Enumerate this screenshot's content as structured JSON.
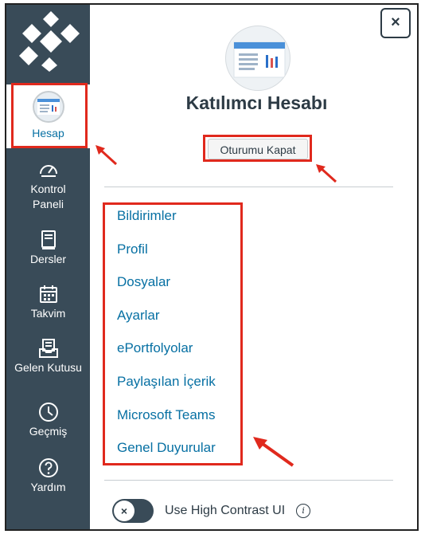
{
  "sidebar": {
    "items": [
      {
        "label": "Hesap",
        "icon": "avatar-icon",
        "active": true
      },
      {
        "label": "Kontrol\nPaneli",
        "icon": "dashboard-icon"
      },
      {
        "label": "Dersler",
        "icon": "courses-icon"
      },
      {
        "label": "Takvim",
        "icon": "calendar-icon"
      },
      {
        "label": "Gelen Kutusu",
        "icon": "inbox-icon"
      },
      {
        "label": "Geçmiş",
        "icon": "clock-icon"
      },
      {
        "label": "Yardım",
        "icon": "help-icon"
      }
    ]
  },
  "panel": {
    "close_label": "×",
    "title": "Katılımcı Hesabı",
    "logout_label": "Oturumu Kapat",
    "menu": [
      "Bildirimler",
      "Profil",
      "Dosyalar",
      "Ayarlar",
      "ePortfolyolar",
      "Paylaşılan İçerik",
      "Microsoft Teams",
      "Genel Duyurular"
    ],
    "contrast_label": "Use High Contrast UI",
    "toggle_symbol": "×",
    "info_symbol": "i"
  },
  "colors": {
    "sidebar_bg": "#394b58",
    "link": "#0770a3",
    "highlight": "#e0291d",
    "text": "#2d3b45"
  }
}
